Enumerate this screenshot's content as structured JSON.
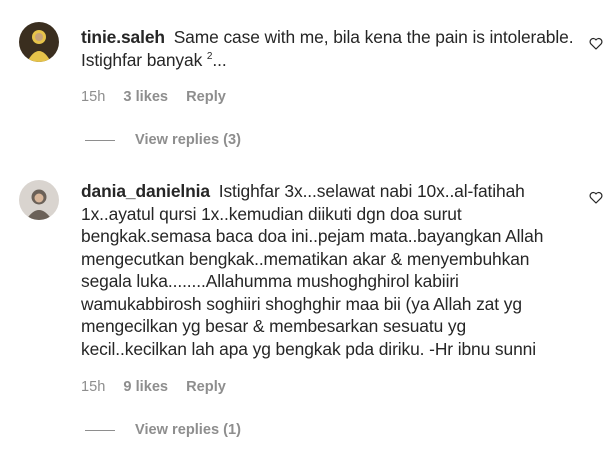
{
  "comments": [
    {
      "username": "tinie.saleh",
      "text_lines": [
        "Same case with me, bila kena the pain is intolerable.",
        "Istighfar banyak"
      ],
      "text_suffix_sup": "2",
      "text_suffix": "...",
      "time": "15h",
      "likes": "3 likes",
      "reply": "Reply",
      "view_replies": "View replies (3)",
      "avatar_colors": {
        "bg": "#3a2e1f",
        "figure": "#e6c34a"
      }
    },
    {
      "username": "dania_danielnia",
      "text_lines": [
        "Istighfar 3x...selawat nabi 10x..al-fatihah",
        "1x..ayatul qursi 1x..kemudian diikuti dgn doa surut",
        "bengkak.semasa baca doa ini..pejam mata..bayangkan Allah",
        "mengecutkan bengkak..mematikan akar & menyembuhkan",
        "segala luka........Allahumma mushoghghirol kabiiri",
        "wamukabbirosh soghiiri shoghghir maa bii (ya Allah zat yg",
        "mengecilkan yg besar & membesarkan sesuatu yg",
        "kecil..kecilkan lah apa yg bengkak pda diriku. -Hr ibnu sunni"
      ],
      "time": "15h",
      "likes": "9 likes",
      "reply": "Reply",
      "view_replies": "View replies (1)",
      "avatar_colors": {
        "bg": "#d9d4cf",
        "figure": "#6b6158"
      }
    }
  ],
  "icons": {
    "like": "heart-outline-icon"
  },
  "colors": {
    "text": "#262626",
    "secondary": "#8e8e8e",
    "background": "#ffffff"
  }
}
